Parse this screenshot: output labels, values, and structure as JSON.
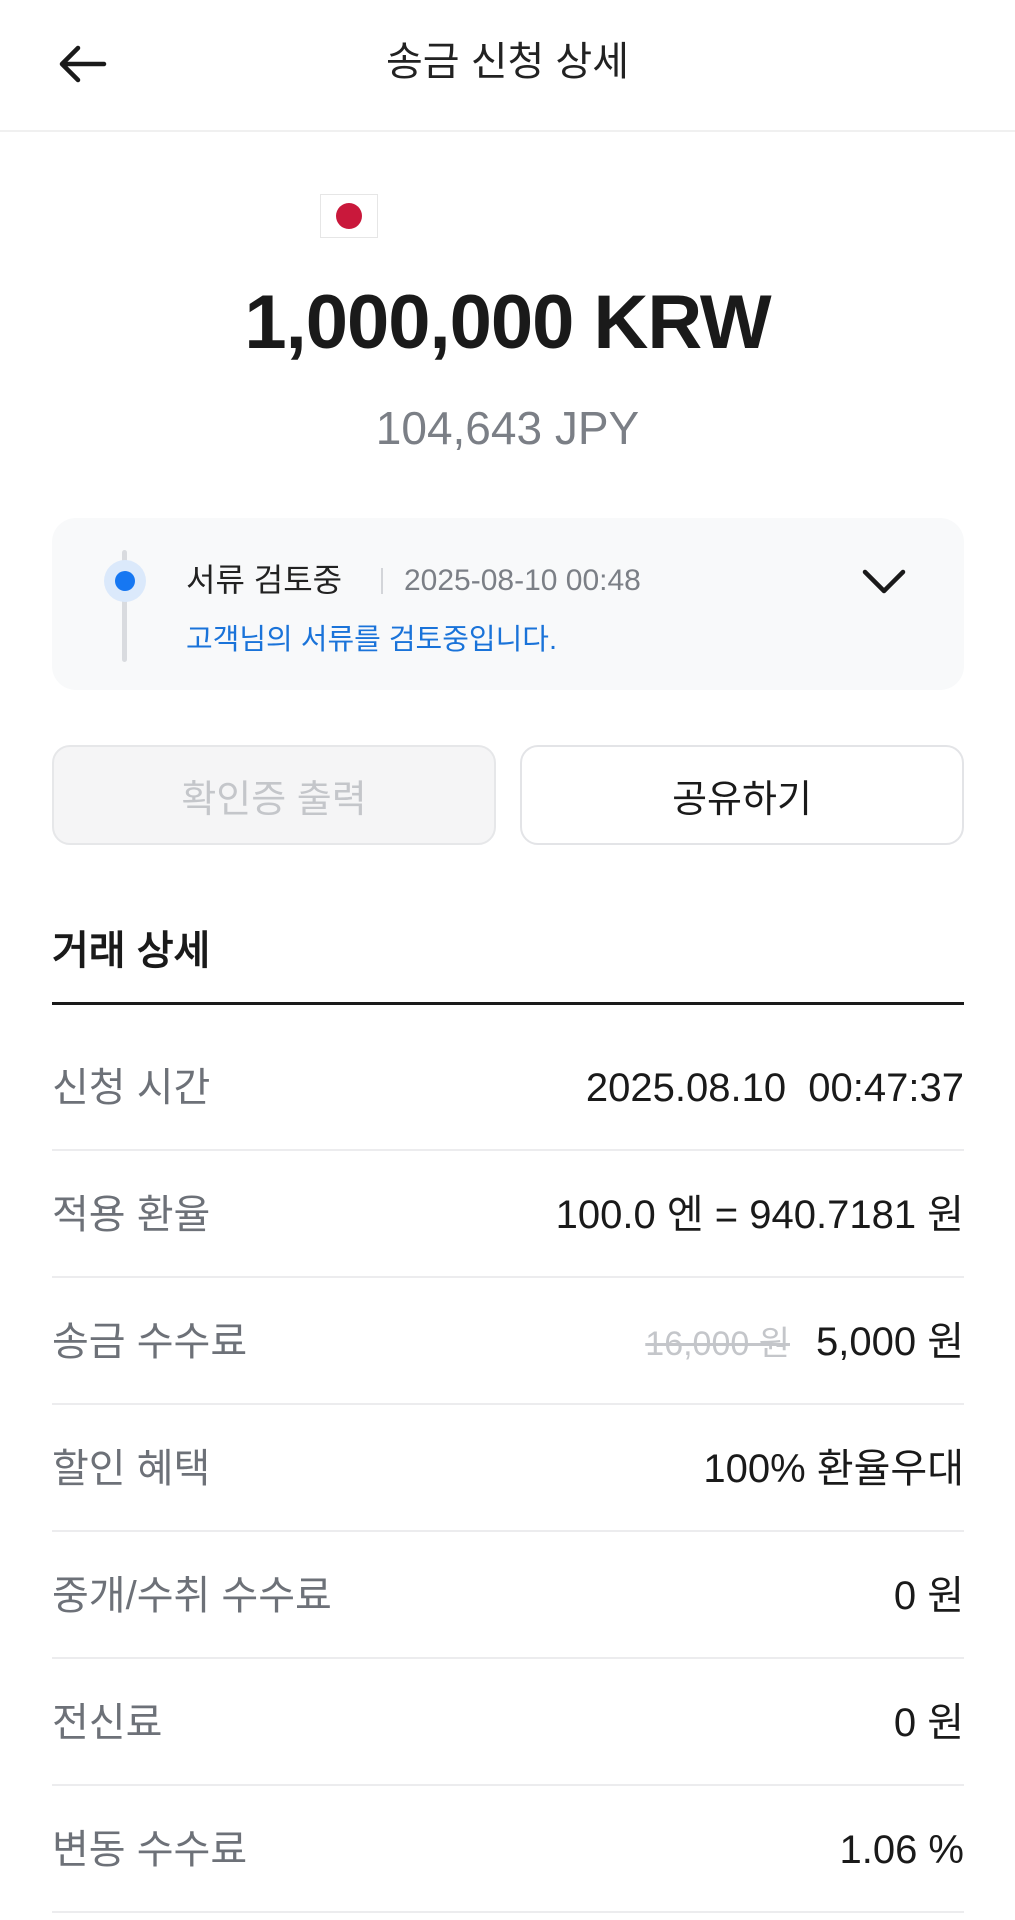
{
  "header": {
    "title": "송금 신청 상세",
    "back_icon": "arrow-left-icon"
  },
  "summary": {
    "flag": "japan-flag-icon",
    "amount_main": "1,000,000 KRW",
    "amount_sub": "104,643 JPY"
  },
  "status": {
    "label": "서류 검토중",
    "time": "2025-08-10 00:48",
    "message": "고객님의 서류를 검토중입니다.",
    "expand_icon": "chevron-down-icon",
    "dot_color": "#1677f2"
  },
  "actions": {
    "print_label": "확인증 출력",
    "share_label": "공유하기"
  },
  "details": {
    "title": "거래 상세",
    "rows": [
      {
        "label": "신청 시간",
        "value": "2025.08.10  00:47:37"
      },
      {
        "label": "적용 환율",
        "value": "100.0 엔 = 940.7181 원"
      },
      {
        "label": "송금 수수료",
        "original": "16,000 원",
        "value": "5,000 원"
      },
      {
        "label": "할인 혜택",
        "value": "100% 환율우대"
      },
      {
        "label": "중개/수취 수수료",
        "value": "0 원"
      },
      {
        "label": "전신료",
        "value": "0 원"
      },
      {
        "label": "변동 수수료",
        "value": "1.06 %"
      }
    ]
  }
}
